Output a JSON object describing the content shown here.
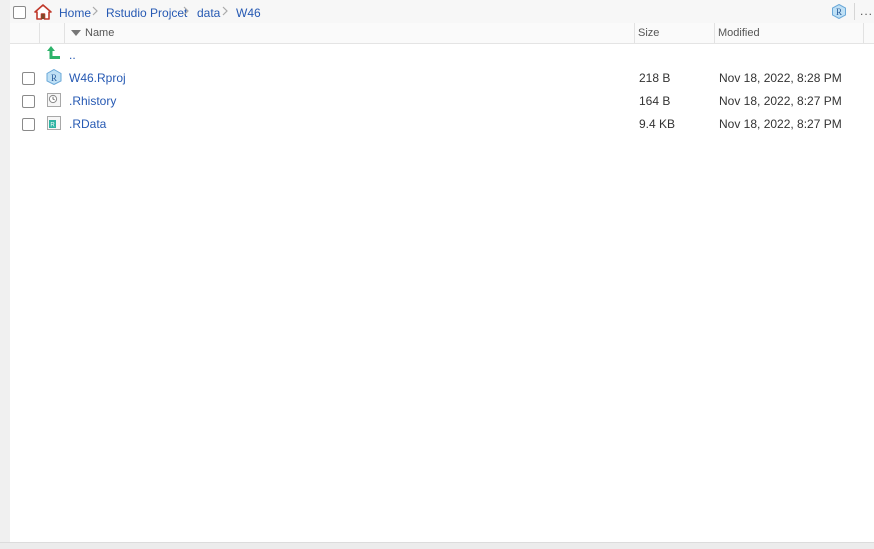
{
  "breadcrumb": {
    "items": [
      "Home",
      "Rstudio Projcet",
      "data",
      "W46"
    ],
    "more_label": "..."
  },
  "columns": {
    "name": "Name",
    "size": "Size",
    "modified": "Modified"
  },
  "parent_link": "..",
  "files": [
    {
      "name": "W46.Rproj",
      "size": "218 B",
      "modified": "Nov 18, 2022, 8:28 PM",
      "icon": "rproj-icon"
    },
    {
      "name": ".Rhistory",
      "size": "164 B",
      "modified": "Nov 18, 2022, 8:27 PM",
      "icon": "rhistory-icon"
    },
    {
      "name": ".RData",
      "size": "9.4 KB",
      "modified": "Nov 18, 2022, 8:27 PM",
      "icon": "rdata-icon"
    }
  ],
  "colors": {
    "link": "#2659b3",
    "home": "#c0392b",
    "up_arrow": "#2db36a"
  }
}
